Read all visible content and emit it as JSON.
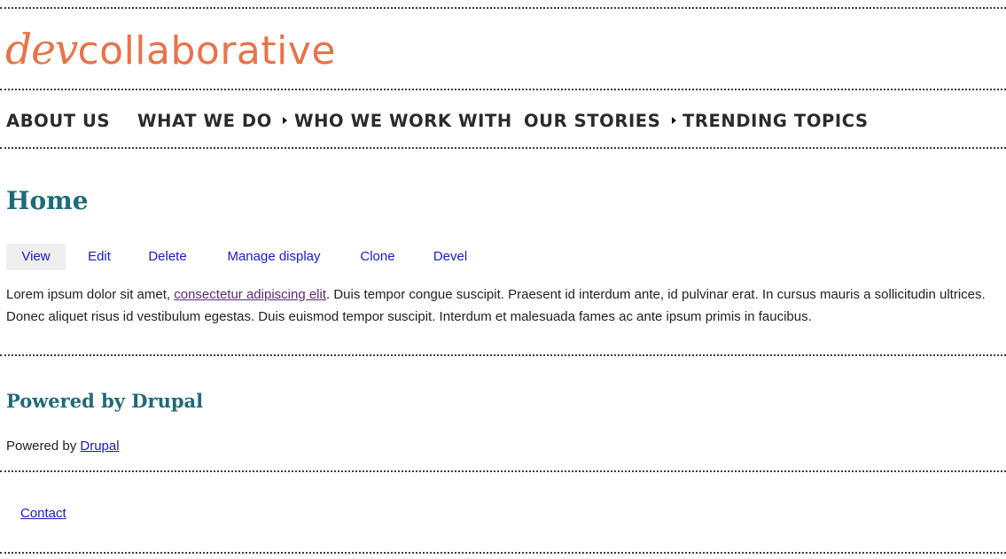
{
  "logo": {
    "script_text": "dev",
    "plain_text": "collaborative",
    "color": "#e8734a"
  },
  "nav": {
    "items": [
      {
        "label": "ABOUT US",
        "has_arrow": false
      },
      {
        "label": "WHAT WE DO",
        "has_arrow": false
      },
      {
        "label": "WHO WE WORK WITH",
        "has_arrow": true
      },
      {
        "label": "OUR STORIES",
        "has_arrow": false
      },
      {
        "label": "TRENDING TOPICS",
        "has_arrow": true
      }
    ],
    "arrow_icon": "triangle-right-icon"
  },
  "main": {
    "title": "Home",
    "tabs": [
      {
        "label": "View",
        "active": true
      },
      {
        "label": "Edit",
        "active": false
      },
      {
        "label": "Delete",
        "active": false
      },
      {
        "label": "Manage display",
        "active": false
      },
      {
        "label": "Clone",
        "active": false
      },
      {
        "label": "Devel",
        "active": false
      }
    ],
    "body": {
      "before_link": "Lorem ipsum dolor sit amet, ",
      "link_text": "consectetur adipiscing elit",
      "after_link": ". Duis tempor congue suscipit. Praesent id interdum ante, id pulvinar erat. In cursus mauris a sollicitudin ultrices. Donec aliquet risus id vestibulum egestas. Duis euismod tempor suscipit. Interdum et malesuada fames ac ante ipsum primis in faucibus."
    }
  },
  "powered_block": {
    "title": "Powered by Drupal",
    "text_before": "Powered by ",
    "link_text": "Drupal"
  },
  "footer": {
    "contact_label": "Contact"
  },
  "colors": {
    "heading": "#1e6b78",
    "link": "#1a1acc",
    "visited_link": "#5a2a7a",
    "active_tab_bg": "#eeeeee"
  }
}
